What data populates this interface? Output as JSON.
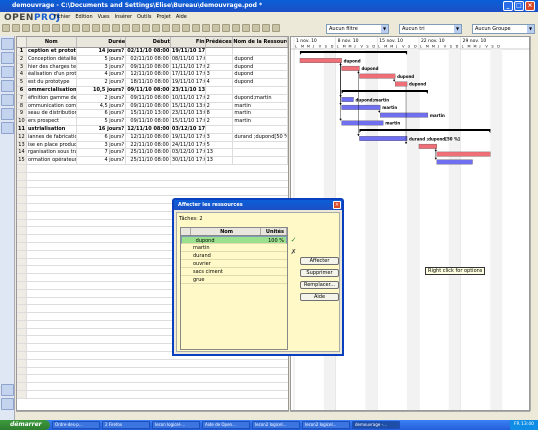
{
  "window": {
    "title": "demouvrage - C:\\Documents and Settings\\Elise\\Bureau\\demouvrage.pod *"
  },
  "logo": {
    "text_a": "OPEN",
    "text_b": "PROJ"
  },
  "menu": [
    "Fichier",
    "Edition",
    "Vues",
    "Insérer",
    "Outils",
    "Projet",
    "Aide"
  ],
  "filters": {
    "filter": "Aucun filtre",
    "sort": "Aucun tri",
    "group": "Aucun Groupe"
  },
  "table": {
    "columns": [
      "",
      "Nom",
      "Durée",
      "Début",
      "Fin",
      "Prédécess...",
      "Nom de la Ressource"
    ],
    "rows": [
      {
        "id": "1",
        "name": "ception et prototyp",
        "duration": "14 jours?",
        "start": "02/11/10 08:00",
        "end": "19/11/10 17:00",
        "pred": "",
        "res": "",
        "summary": true
      },
      {
        "id": "2",
        "name": "Conception détaillée",
        "duration": "5 jours?",
        "start": "02/11/10 08:00",
        "end": "08/11/10 17:00",
        "pred": "",
        "res": "dupond",
        "summary": false
      },
      {
        "id": "3",
        "name": "hier des charges technic",
        "duration": "3 jours?",
        "start": "09/11/10 08:00",
        "end": "11/11/10 17:00",
        "pred": "2",
        "res": "dupond",
        "summary": false
      },
      {
        "id": "4",
        "name": "éalisation d'un prototype",
        "duration": "4 jours?",
        "start": "12/11/10 08:00",
        "end": "17/11/10 17:00",
        "pred": "3",
        "res": "dupond",
        "summary": false
      },
      {
        "id": "5",
        "name": "est du prototype",
        "duration": "2 jours?",
        "start": "18/11/10 08:00",
        "end": "19/11/10 17:00",
        "pred": "4",
        "res": "dupond",
        "summary": false
      },
      {
        "id": "6",
        "name": "ommercialisation",
        "duration": "10,5 jours?",
        "start": "09/11/10 08:00",
        "end": "23/11/10 13:00",
        "pred": "",
        "res": "",
        "summary": true
      },
      {
        "id": "7",
        "name": "éfinition gamme de prod",
        "duration": "2 jours?",
        "start": "09/11/10 08:00",
        "end": "10/11/10 17:00",
        "pred": "2",
        "res": "dupond;martin",
        "summary": false
      },
      {
        "id": "8",
        "name": "ommunication commercial",
        "duration": "4,5 jours?",
        "start": "09/11/10 08:00",
        "end": "15/11/10 13:00",
        "pred": "2",
        "res": "martin",
        "summary": false
      },
      {
        "id": "9",
        "name": "seau de distribution",
        "duration": "6 jours?",
        "start": "15/11/10 13:00",
        "end": "23/11/10 13:00",
        "pred": "8",
        "res": "martin",
        "summary": false
      },
      {
        "id": "10",
        "name": "ers prospect",
        "duration": "5 jours?",
        "start": "09/11/10 08:00",
        "end": "15/11/10 17:00",
        "pred": "2",
        "res": "martin",
        "summary": false
      },
      {
        "id": "11",
        "name": "ustrialisation",
        "duration": "16 jours?",
        "start": "12/11/10 08:00",
        "end": "03/12/10 17:00",
        "pred": "",
        "res": "",
        "summary": true
      },
      {
        "id": "12",
        "name": "iannes de fabrication",
        "duration": "6 jours?",
        "start": "12/11/10 08:00",
        "end": "19/11/10 17:00",
        "pred": "3",
        "res": "durand ;dupond[50 %]",
        "summary": false
      },
      {
        "id": "13",
        "name": "ise en place production",
        "duration": "3 jours?",
        "start": "22/11/10 08:00",
        "end": "24/11/10 17:00",
        "pred": "5",
        "res": "",
        "summary": false
      },
      {
        "id": "14",
        "name": "rganisation sous traitanc",
        "duration": "7 jours?",
        "start": "25/11/10 08:00",
        "end": "03/12/10 17:00",
        "pred": "13",
        "res": "",
        "summary": false
      },
      {
        "id": "15",
        "name": "ormation opérateurs",
        "duration": "4 jours?",
        "start": "25/11/10 08:00",
        "end": "30/11/10 17:00",
        "pred": "13",
        "res": "",
        "summary": false
      }
    ]
  },
  "gantt": {
    "weeks": [
      "1 nov. 10",
      "8 nov. 10",
      "15 nov. 10",
      "22 nov. 10",
      "29 nov. 10"
    ],
    "day_letters": [
      "L",
      "M",
      "M",
      "J",
      "V",
      "S",
      "D"
    ],
    "labels": {
      "r2": "dupond",
      "r3": "dupond",
      "r4": "dupond",
      "r5": "dupond",
      "r7": "dupond;martin",
      "r8": "martin",
      "r9": "martin",
      "r10": "martin",
      "r12": "durand ;dupond[50 %]"
    },
    "colors": {
      "critical": "#ef6f78",
      "normal": "#6f6fef",
      "summary": "#000000"
    }
  },
  "tooltip": "Right click for options",
  "dialog": {
    "title": "Affecter les ressources",
    "task_label": "Tâches: 2",
    "columns": [
      "",
      "Nom",
      "Unités"
    ],
    "resources": [
      {
        "name": "dupond",
        "units": "100 %",
        "selected": true
      },
      {
        "name": "martin",
        "units": "",
        "selected": false
      },
      {
        "name": "durand",
        "units": "",
        "selected": false
      },
      {
        "name": "ouvrier",
        "units": "",
        "selected": false
      },
      {
        "name": "sacs ciment",
        "units": "",
        "selected": false
      },
      {
        "name": "grue",
        "units": "",
        "selected": false
      }
    ],
    "buttons": {
      "assign": "Affecter",
      "remove": "Supprimer",
      "replace": "Remplacer...",
      "help": "Aide"
    }
  },
  "taskbar": {
    "start": "démarrer",
    "items": [
      "Ordre-des-p...",
      "2 Firefox",
      "lecon logicel-...",
      "Aide de Open...",
      "lecon2 logicel...",
      "lecon2 logicel...",
      "demouvrage -..."
    ],
    "clock": "13:40",
    "lang": "FR"
  }
}
